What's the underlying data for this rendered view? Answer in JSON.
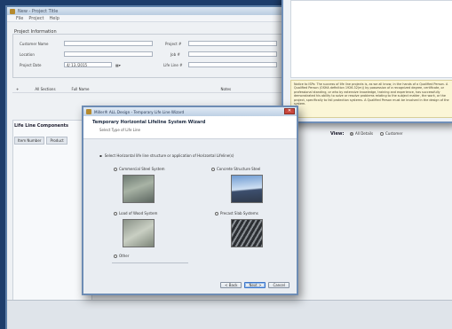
{
  "app": {
    "title": "New - Project Title",
    "menu": [
      "File",
      "Project",
      "Help"
    ]
  },
  "project": {
    "group_title": "Project Information",
    "fields": {
      "customer_name": "Customer Name",
      "location": "Location",
      "project_date": "Project Date",
      "project_date_value": "4/ 13 /2015",
      "project_number": "Project #",
      "job_number": "Job #",
      "life_line_number": "Life Line #"
    }
  },
  "tree": {
    "item": "All Sections",
    "column": "Full Name",
    "right": "Notes"
  },
  "components": {
    "label": "Life Line Components",
    "tab1": "Item Number",
    "tab2": "Product"
  },
  "view": {
    "label": "View:",
    "option1": "All Details",
    "option2": "Customer"
  },
  "help": {
    "note": "Notice to ISPs: The success of life line projects is, as we all know, in the hands of a Qualified Person. A Qualified Person (OSHA definition 1926.32(m)) by possession of a recognized degree, certificate, or professional standing, or who by extensive knowledge, training and experience, has successfully demonstrated his ability to solve or resolve problems relating to the subject matter, the work, or the project, specifically to fall protection systems. A Qualified Person must be involved in the design of the system."
  },
  "wizard": {
    "window_title": "Miller® ALL Design - Temporary Life Line Wizard",
    "close": "✕",
    "heading": "Temporary Horizontal Lifeline System Wizard",
    "subheading": "Select Type of Life Line",
    "instruction": "Select Horizontal life line structure or application of Horizontal Lifeline(s)",
    "options": {
      "commercial": "Commercial Steel System",
      "concrete": "Concrete Structure Steel",
      "wood": "Load of Wood System",
      "roof": "Precast Slab Systems",
      "other": "Other"
    },
    "buttons": {
      "back": "< Back",
      "next": "Next >",
      "cancel": "Cancel"
    }
  }
}
